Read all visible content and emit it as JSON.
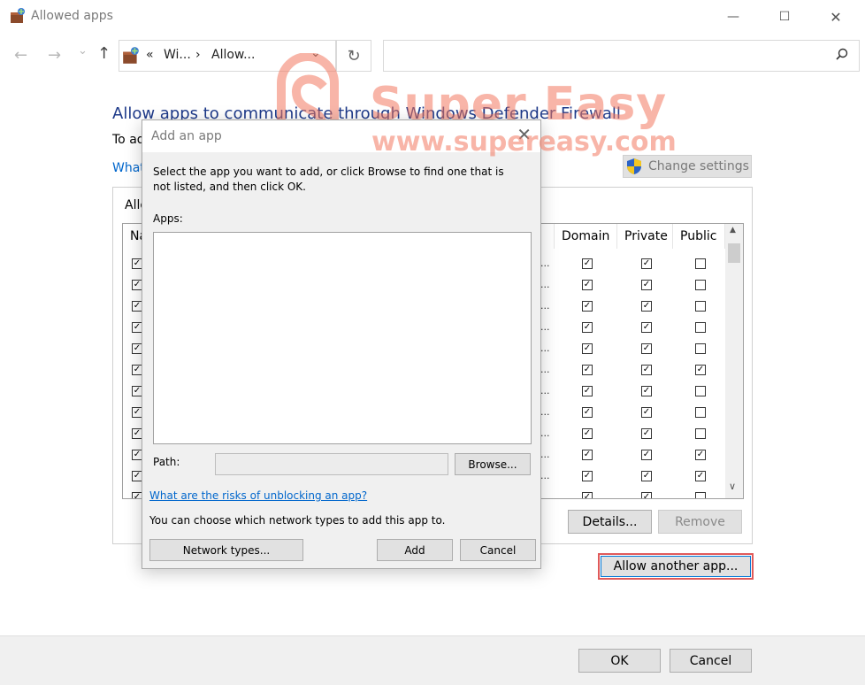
{
  "window": {
    "title": "Allowed apps",
    "min_glyph": "—",
    "max_glyph": "☐",
    "close_glyph": "✕"
  },
  "nav": {
    "back_glyph": "←",
    "forward_glyph": "→",
    "recent_glyph": "⌄",
    "up_glyph": "↑",
    "crumb_prefix": "«",
    "crumb1": "Wi...",
    "separator": "›",
    "crumb2": "Allow...",
    "dropdown_glyph": "⌄",
    "refresh_glyph": "↻",
    "search_glyph": "⚲"
  },
  "main": {
    "heading": "Allow apps to communicate through Windows Defender Firewall",
    "subtext": "To ad",
    "link": "What",
    "change_settings": "Change settings",
    "group_title": "Allo",
    "columns": {
      "name": "Na",
      "domain": "Domain",
      "private": "Private",
      "public": "Public"
    },
    "rows": [
      {
        "name": true,
        "domain": true,
        "private": true,
        "public": false
      },
      {
        "name": true,
        "domain": true,
        "private": true,
        "public": false
      },
      {
        "name": true,
        "domain": true,
        "private": true,
        "public": false
      },
      {
        "name": true,
        "domain": true,
        "private": true,
        "public": false
      },
      {
        "name": true,
        "domain": true,
        "private": true,
        "public": false
      },
      {
        "name": true,
        "domain": true,
        "private": true,
        "public": true
      },
      {
        "name": true,
        "domain": true,
        "private": true,
        "public": false
      },
      {
        "name": true,
        "domain": true,
        "private": true,
        "public": false
      },
      {
        "name": true,
        "domain": true,
        "private": true,
        "public": false
      },
      {
        "name": true,
        "domain": true,
        "private": true,
        "public": true
      },
      {
        "name": true,
        "domain": true,
        "private": true,
        "public": true
      },
      {
        "name": true,
        "domain": true,
        "private": true,
        "public": false
      }
    ],
    "ellipsis": "...",
    "check_glyph": "✓",
    "scroll_up_glyph": "▲",
    "scroll_down_glyph": "∨",
    "details_button": "Details...",
    "remove_button": "Remove",
    "allow_another_button": "Allow another app..."
  },
  "footer": {
    "ok_button": "OK",
    "cancel_button": "Cancel"
  },
  "dialog": {
    "title": "Add an app",
    "close_glyph": "✕",
    "instructions": "Select the app you want to add, or click Browse to find one that is not listed, and then click OK.",
    "apps_label": "Apps:",
    "path_label": "Path:",
    "browse_button": "Browse...",
    "risks_link": "What are the risks of unblocking an app?",
    "network_text": "You can choose which network types to add this app to.",
    "network_types_button": "Network types...",
    "add_button": "Add",
    "cancel_button": "Cancel"
  },
  "watermark": {
    "brand": "Super Easy",
    "url": "www.supereasy.com"
  },
  "colors": {
    "heading": "#1e3a8a",
    "link": "#0066cc",
    "highlight": "#e05a5a",
    "watermark": "#f27860"
  }
}
